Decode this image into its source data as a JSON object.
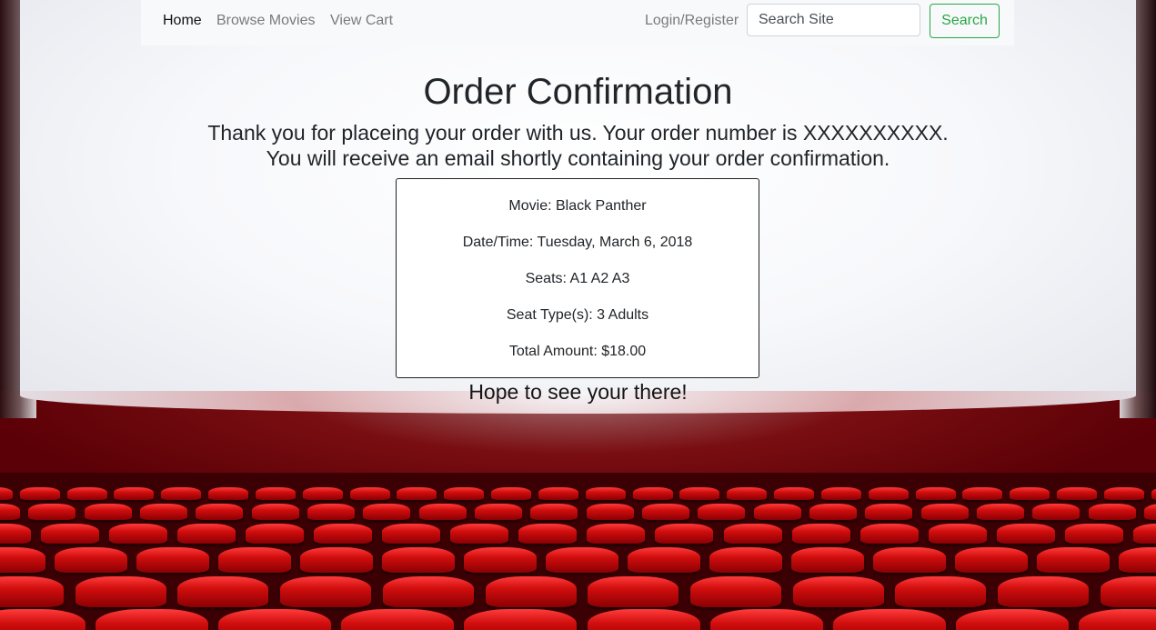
{
  "nav": {
    "home": "Home",
    "browse_movies": "Browse Movies",
    "view_cart": "View Cart",
    "login_register": "Login/Register",
    "search_placeholder": "Search Site",
    "search_button": "Search"
  },
  "page": {
    "title": "Order Confirmation",
    "thanks_line1": "Thank you for placeing your order with us. Your order number is XXXXXXXXXX.",
    "thanks_line2": "You will receive an email shortly containing your order confirmation.",
    "closing": "Hope to see your there!"
  },
  "order": {
    "movie": "Movie: Black Panther",
    "datetime": "Date/Time: Tuesday, March 6, 2018",
    "seats": "Seats: A1 A2 A3",
    "seat_types": "Seat Type(s): 3 Adults",
    "total": "Total Amount: $18.00"
  },
  "colors": {
    "accent_green": "#28a745",
    "seat_red": "#d00d0d"
  }
}
